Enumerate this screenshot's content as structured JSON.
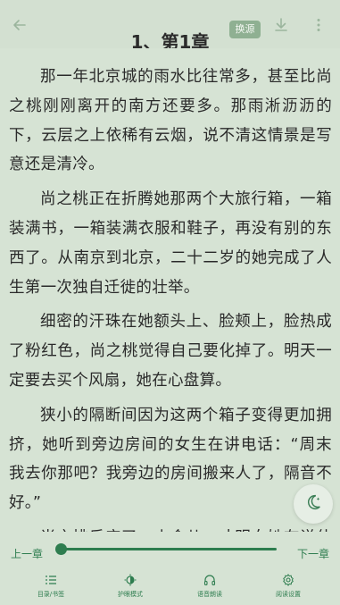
{
  "toolbar": {
    "back_icon": "arrow-left-icon",
    "change_source_label": "换源",
    "download_icon": "download-icon",
    "more_icon": "more-vertical-icon"
  },
  "chapter": {
    "title": "1、第1章",
    "paragraphs": [
      "那一年北京城的雨水比往常多，甚至比尚之桃刚刚离开的南方还要多。那雨淅沥沥的下，云层之上依稀有云烟，说不清这情景是写意还是清冷。",
      "尚之桃正在折腾她那两个大旅行箱，一箱装满书，一箱装满衣服和鞋子，再没有别的东西了。从南京到北京，二十二岁的她完成了人生第一次独自迁徙的壮举。",
      "细密的汗珠在她额头上、脸颊上，脸热成了粉红色，尚之桃觉得自己要化掉了。明天一定要去买个风扇，她在心盘算。",
      "狭小的隔断间因为这两个箱子变得更加拥挤，她听到旁边房间的女生在讲电话：“周末我去你那吧？我旁边的房间搬来人了，隔音不好。”",
      "尚之桃反应了一小会儿，才明白她在说什么"
    ]
  },
  "night_mode_icon": "moon-icon",
  "progress": {
    "prev_label": "上一章",
    "next_label": "下一章",
    "value": 0.0
  },
  "bottom_tabs": [
    {
      "icon": "list-icon",
      "label": "目录/书签"
    },
    {
      "icon": "brightness-icon",
      "label": "护眼模式"
    },
    {
      "icon": "headphones-icon",
      "label": "语音朗读"
    },
    {
      "icon": "gear-icon",
      "label": "阅读设置"
    }
  ],
  "colors": {
    "background": "#d6e3d4",
    "accent": "#2e7d4f",
    "text": "#2a2a2a"
  }
}
